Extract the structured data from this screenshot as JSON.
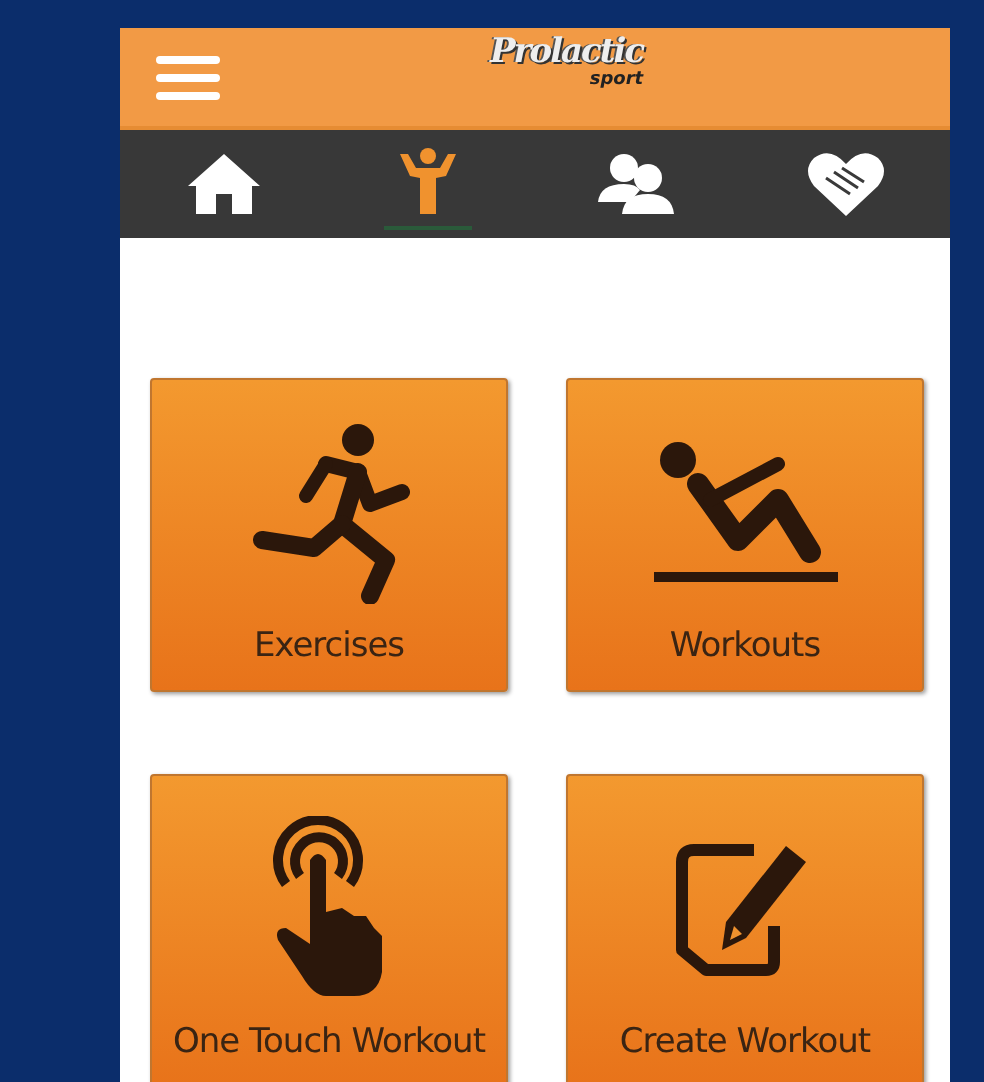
{
  "header": {
    "logo": {
      "text": "Prolactic",
      "subtext": "sport"
    }
  },
  "nav": [
    {
      "kind": "home",
      "selected": false
    },
    {
      "kind": "fitness",
      "selected": true
    },
    {
      "kind": "people",
      "selected": false
    },
    {
      "kind": "heart",
      "selected": false
    }
  ],
  "tiles": [
    {
      "kind": "runner",
      "label": "Exercises"
    },
    {
      "kind": "situp",
      "label": "Workouts"
    },
    {
      "kind": "touch",
      "label": "One Touch Workout"
    },
    {
      "kind": "edit",
      "label": "Create Workout"
    }
  ]
}
